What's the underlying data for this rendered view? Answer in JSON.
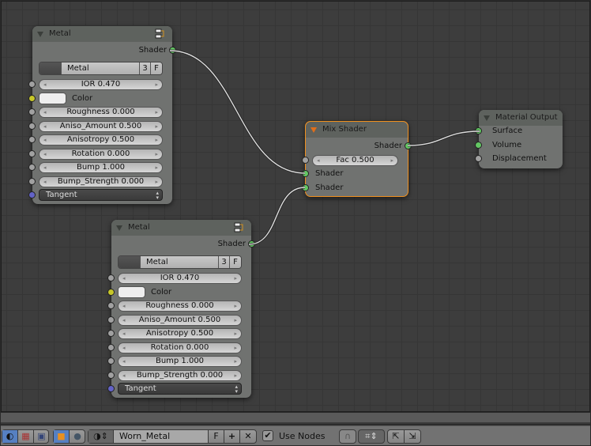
{
  "nodes": {
    "metal1": {
      "title": "Metal",
      "output": "Shader",
      "script_name": "Metal",
      "users": "3",
      "fake": "F",
      "inputs": [
        {
          "label": "IOR 0.470",
          "kind": "num",
          "socket": "gray"
        },
        {
          "label": "Color",
          "kind": "color",
          "socket": "yellow"
        },
        {
          "label": "Roughness 0.000",
          "kind": "num",
          "socket": "gray"
        },
        {
          "label": "Aniso_Amount 0.500",
          "kind": "num",
          "socket": "gray"
        },
        {
          "label": "Anisotropy 0.500",
          "kind": "num",
          "socket": "gray"
        },
        {
          "label": "Rotation 0.000",
          "kind": "num",
          "socket": "gray"
        },
        {
          "label": "Bump 1.000",
          "kind": "num",
          "socket": "gray"
        },
        {
          "label": "Bump_Strength 0.000",
          "kind": "num",
          "socket": "gray"
        },
        {
          "label": "Tangent",
          "kind": "select",
          "socket": "blue"
        }
      ]
    },
    "metal2": {
      "title": "Metal",
      "output": "Shader",
      "script_name": "Metal",
      "users": "3",
      "fake": "F",
      "inputs": [
        {
          "label": "IOR 0.470",
          "kind": "num",
          "socket": "gray"
        },
        {
          "label": "Color",
          "kind": "color",
          "socket": "yellow"
        },
        {
          "label": "Roughness 0.000",
          "kind": "num",
          "socket": "gray"
        },
        {
          "label": "Aniso_Amount 0.500",
          "kind": "num",
          "socket": "gray"
        },
        {
          "label": "Anisotropy 0.500",
          "kind": "num",
          "socket": "gray"
        },
        {
          "label": "Rotation 0.000",
          "kind": "num",
          "socket": "gray"
        },
        {
          "label": "Bump 1.000",
          "kind": "num",
          "socket": "gray"
        },
        {
          "label": "Bump_Strength 0.000",
          "kind": "num",
          "socket": "gray"
        },
        {
          "label": "Tangent",
          "kind": "select",
          "socket": "blue"
        }
      ]
    },
    "mix": {
      "title": "Mix Shader",
      "output": "Shader",
      "fac": "Fac 0.500",
      "input1": "Shader",
      "input2": "Shader"
    },
    "output": {
      "title": "Material Output",
      "inputs": [
        "Surface",
        "Volume",
        "Displacement"
      ]
    }
  },
  "header": {
    "material_name": "Worn_Metal",
    "fake_user": "F",
    "use_nodes_label": "Use Nodes",
    "use_nodes_checked": true
  },
  "colors": {
    "socket_shader": "#63c763",
    "socket_color": "#c7c729",
    "socket_float": "#a1a1a1",
    "socket_vector": "#6363c7",
    "active_outline": "#f0901e"
  }
}
